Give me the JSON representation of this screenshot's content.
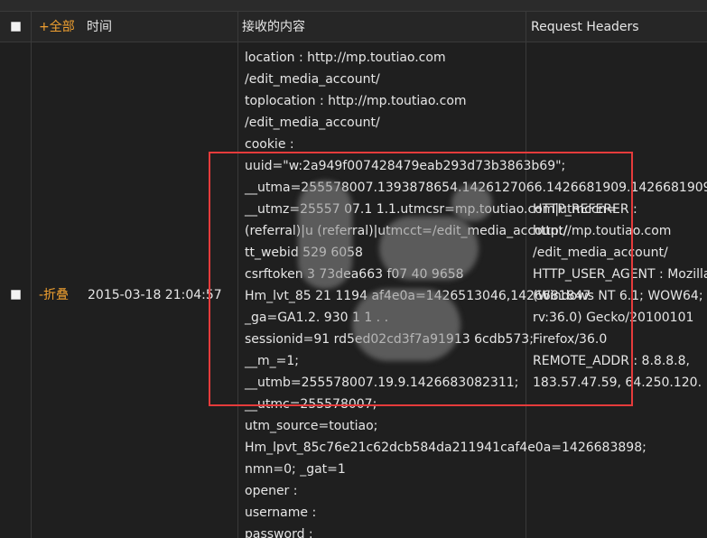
{
  "header": {
    "all_label": "+全部",
    "time_label": "时间",
    "content_label": "接收的内容",
    "request_headers_label": "Request Headers"
  },
  "row": {
    "collapse_label": "-折叠",
    "timestamp": "2015-03-18 21:04:57",
    "content_lines": [
      "location : http://mp.toutiao.com",
      "/edit_media_account/",
      "toplocation : http://mp.toutiao.com",
      "/edit_media_account/",
      "cookie :",
      "uuid=\"w:2a949f007428479eab293d73b3863b69\";",
      "__utma=255578007.1393878654.1426127066.1426681909.1426681909",
      "__utmz=25557 07.1 1.1.utmcsr=mp.toutiao.com|utmccn=",
      "(referral)|u (referral)|utmcct=/edit_media_account/",
      "tt_webid 529 6058",
      "csrftoken 3 73dea663 f07 40 9658",
      "Hm_lvt_85 21 1194 af4e0a=1426513046,1426681847",
      "_ga=GA1.2. 930 1 1 . .",
      "sessionid=91 rd5ed02cd3f7a91913 6cdb573;",
      "__m_=1;",
      "__utmb=255578007.19.9.1426683082311;",
      "__utmc=255578007;",
      "utm_source=toutiao;",
      "Hm_lpvt_85c76e21c62dcb584da211941caf4e0a=1426683898;",
      "nmn=0; _gat=1",
      "opener :",
      "username :",
      "password :"
    ],
    "header_lines": [
      "HTTP_REFERER :",
      "http://mp.toutiao.com",
      "/edit_media_account/",
      "HTTP_USER_AGENT : Mozilla/5.0",
      "(Windows NT 6.1; WOW64;",
      "rv:36.0) Gecko/20100101",
      "Firefox/36.0",
      "REMOTE_ADDR : 8.8.8.8,",
      "183.57.47.59, 64.250.120."
    ]
  },
  "colors": {
    "accent": "#f0a030",
    "highlight_box": "#e53b3b",
    "background": "#1f1f1f"
  }
}
